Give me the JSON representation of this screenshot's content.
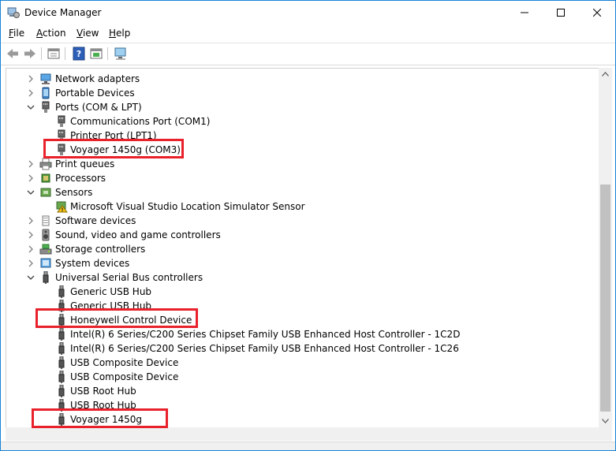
{
  "window": {
    "title": "Device Manager",
    "controls": {
      "minimize": "minimize-icon",
      "maximize": "maximize-icon",
      "close": "close-icon"
    }
  },
  "menu": [
    {
      "accel": "F",
      "rest": "ile"
    },
    {
      "accel": "A",
      "rest": "ction"
    },
    {
      "accel": "V",
      "rest": "iew"
    },
    {
      "accel": "H",
      "rest": "elp"
    }
  ],
  "toolbar": [
    "back-icon",
    "forward-icon",
    "properties-icon",
    "help-icon",
    "update-driver-icon",
    "scan-hardware-icon"
  ],
  "tree": {
    "rows": [
      {
        "label": "Network adapters",
        "level": 1,
        "expander": "collapsed",
        "icon": "network-adapter-icon"
      },
      {
        "label": "Portable Devices",
        "level": 1,
        "expander": "collapsed",
        "icon": "portable-device-icon"
      },
      {
        "label": "Ports (COM & LPT)",
        "level": 1,
        "expander": "expanded",
        "icon": "port-icon"
      },
      {
        "label": "Communications Port (COM1)",
        "level": 2,
        "expander": "none",
        "icon": "port-icon"
      },
      {
        "label": "Printer Port (LPT1)",
        "level": 2,
        "expander": "none",
        "icon": "port-icon"
      },
      {
        "label": "Voyager 1450g (COM3)",
        "level": 2,
        "expander": "none",
        "icon": "port-icon"
      },
      {
        "label": "Print queues",
        "level": 1,
        "expander": "collapsed",
        "icon": "printer-icon"
      },
      {
        "label": "Processors",
        "level": 1,
        "expander": "collapsed",
        "icon": "processor-icon"
      },
      {
        "label": "Sensors",
        "level": 1,
        "expander": "expanded",
        "icon": "sensor-icon"
      },
      {
        "label": "Microsoft Visual Studio Location Simulator Sensor",
        "level": 2,
        "expander": "none",
        "icon": "warning-sensor-icon"
      },
      {
        "label": "Software devices",
        "level": 1,
        "expander": "collapsed",
        "icon": "software-device-icon"
      },
      {
        "label": "Sound, video and game controllers",
        "level": 1,
        "expander": "collapsed",
        "icon": "speaker-icon"
      },
      {
        "label": "Storage controllers",
        "level": 1,
        "expander": "collapsed",
        "icon": "storage-icon"
      },
      {
        "label": "System devices",
        "level": 1,
        "expander": "collapsed",
        "icon": "system-device-icon"
      },
      {
        "label": "Universal Serial Bus controllers",
        "level": 1,
        "expander": "expanded",
        "icon": "usb-icon"
      },
      {
        "label": "Generic USB Hub",
        "level": 2,
        "expander": "none",
        "icon": "usb-icon"
      },
      {
        "label": "Generic USB Hub",
        "level": 2,
        "expander": "none",
        "icon": "usb-icon"
      },
      {
        "label": "Honeywell Control Device",
        "level": 2,
        "expander": "none",
        "icon": "usb-icon"
      },
      {
        "label": "Intel(R) 6 Series/C200 Series Chipset Family USB Enhanced Host Controller - 1C2D",
        "level": 2,
        "expander": "none",
        "icon": "usb-icon"
      },
      {
        "label": "Intel(R) 6 Series/C200 Series Chipset Family USB Enhanced Host Controller - 1C26",
        "level": 2,
        "expander": "none",
        "icon": "usb-icon"
      },
      {
        "label": "USB Composite Device",
        "level": 2,
        "expander": "none",
        "icon": "usb-icon"
      },
      {
        "label": "USB Composite Device",
        "level": 2,
        "expander": "none",
        "icon": "usb-icon"
      },
      {
        "label": "USB Root Hub",
        "level": 2,
        "expander": "none",
        "icon": "usb-icon"
      },
      {
        "label": "USB Root Hub",
        "level": 2,
        "expander": "none",
        "icon": "usb-icon"
      },
      {
        "label": "Voyager 1450g",
        "level": 2,
        "expander": "none",
        "icon": "usb-icon"
      }
    ],
    "highlighted": [
      "Voyager 1450g (COM3)",
      "Honeywell Control Device",
      "Voyager 1450g"
    ]
  },
  "colors": {
    "highlight": "#e8212b",
    "window_border": "#1883d7"
  }
}
